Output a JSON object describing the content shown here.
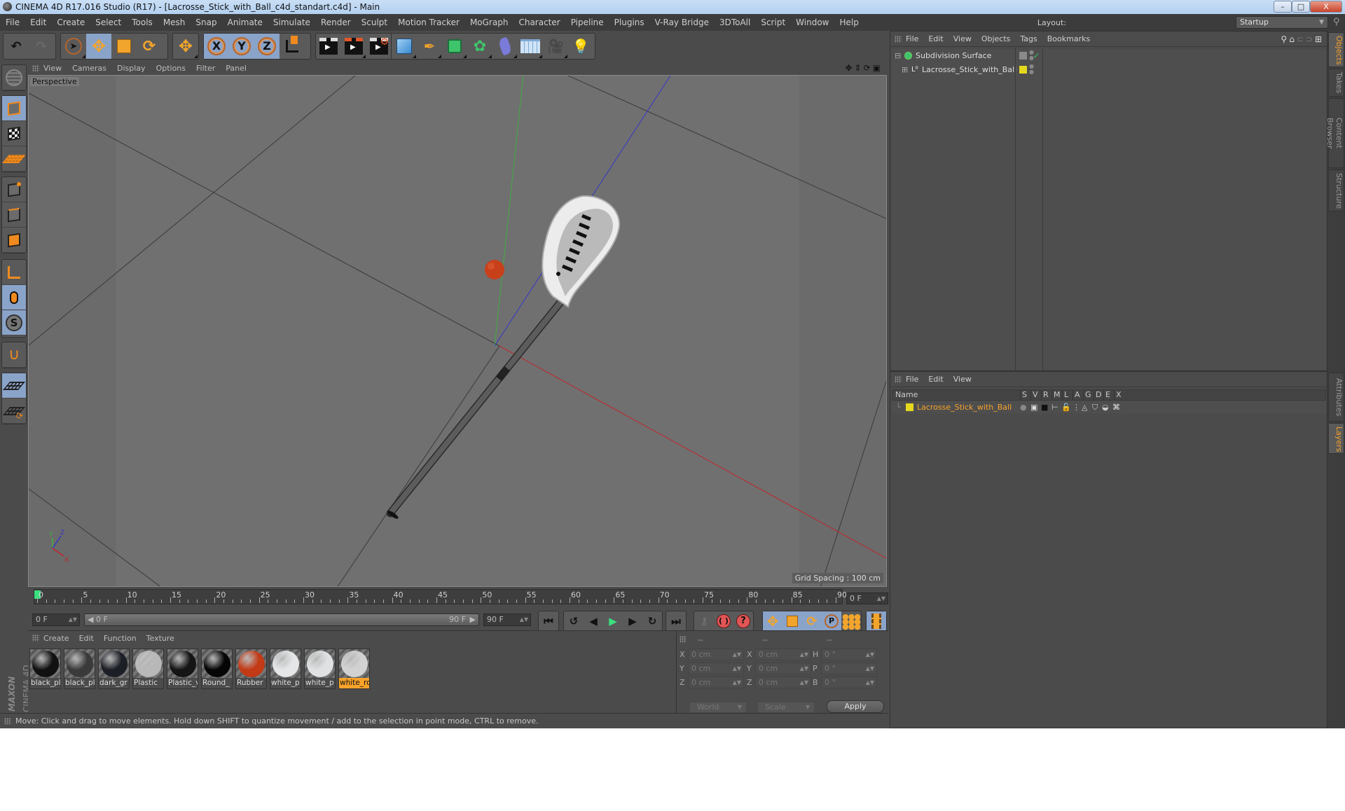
{
  "window": {
    "title": "CINEMA 4D R17.016 Studio (R17) - [Lacrosse_Stick_with_Ball_c4d_standart.c4d] - Main",
    "controls": {
      "minimize": "–",
      "maximize": "□",
      "close": "X"
    }
  },
  "menubar": {
    "items": [
      "File",
      "Edit",
      "Create",
      "Select",
      "Tools",
      "Mesh",
      "Snap",
      "Animate",
      "Simulate",
      "Render",
      "Sculpt",
      "Motion Tracker",
      "MoGraph",
      "Character",
      "Pipeline",
      "Plugins",
      "V-Ray Bridge",
      "3DToAll",
      "Script",
      "Window",
      "Help"
    ],
    "layout_label": "Layout:",
    "layout_value": "Startup"
  },
  "toolbar": {
    "groups": [
      [
        "undo-icon",
        "redo-icon"
      ],
      [
        "live-selection-icon",
        "move-icon",
        "scale-icon",
        "rotate-icon"
      ],
      [
        "recent-tool-icon"
      ],
      [
        "x-axis-icon",
        "y-axis-icon",
        "z-axis-icon",
        "coordinate-system-icon"
      ],
      [
        "render-view-icon",
        "render-picture-viewer-icon",
        "render-settings-icon"
      ],
      [
        "cube-icon",
        "pen-icon",
        "subdivision-icon",
        "cloner-icon",
        "deformer-icon",
        "floor-icon",
        "camera-icon",
        "light-icon"
      ]
    ],
    "axis_labels": [
      "X",
      "Y",
      "Z"
    ]
  },
  "left_tools": [
    "make-editable-icon",
    "model-mode-icon",
    "texture-mode-icon",
    "workplane-mode-icon",
    "points-mode-icon",
    "edges-mode-icon",
    "polygons-mode-icon",
    "axis-mode-icon",
    "tweak-mode-icon",
    "solo-icon",
    "snap-icon",
    "lock-workplane-icon",
    "workplane-align-icon"
  ],
  "viewport": {
    "menu": [
      "View",
      "Cameras",
      "Display",
      "Options",
      "Filter",
      "Panel"
    ],
    "camera_label": "Perspective",
    "grid_spacing": "Grid Spacing : 100 cm",
    "nav_icons": [
      "pan-icon",
      "dolly-icon",
      "orbit-icon",
      "maximize-view-icon"
    ],
    "axis_labels": {
      "x": "X",
      "y": "Y",
      "z": "Z"
    }
  },
  "timeline": {
    "ticks": [
      "0",
      "5",
      "10",
      "15",
      "20",
      "25",
      "30",
      "35",
      "40",
      "45",
      "50",
      "55",
      "60",
      "65",
      "70",
      "75",
      "80",
      "85",
      "90"
    ],
    "current_frame": "0 F",
    "start_frame": "0 F",
    "range_start": "0 F",
    "range_end": "90 F",
    "end_frame": "90 F",
    "playhead_frame": 0
  },
  "playback": {
    "buttons": [
      "go-to-start",
      "go-to-previous-key",
      "previous-frame",
      "play-forward",
      "next-frame",
      "go-to-next-key",
      "go-to-end",
      "record-keys",
      "autokeying",
      "keyframe-selection",
      "key-position",
      "key-scale",
      "key-rotation",
      "key-parameter",
      "key-pla",
      "timeline-window"
    ]
  },
  "materials": {
    "menu": [
      "Create",
      "Edit",
      "Function",
      "Texture"
    ],
    "items": [
      {
        "name": "black_pl",
        "color": "#111111",
        "selected": false
      },
      {
        "name": "black_pl",
        "color": "#3a3a3a",
        "selected": false
      },
      {
        "name": "dark_gr",
        "color": "#1d1f26",
        "selected": false
      },
      {
        "name": "Plastic",
        "color": "#b8b8b8",
        "selected": false
      },
      {
        "name": "Plastic_v",
        "color": "#151515",
        "selected": false
      },
      {
        "name": "Round_",
        "color": "#050505",
        "selected": false
      },
      {
        "name": "Rubber",
        "color": "#c23a16",
        "selected": false
      },
      {
        "name": "white_p",
        "color": "#e4e6e8",
        "selected": false
      },
      {
        "name": "white_p",
        "color": "#dfe1e3",
        "selected": false
      },
      {
        "name": "white_ro",
        "color": "#d2d2d2",
        "selected": true
      }
    ],
    "brand_top": "MAXON",
    "brand_bottom": "CINEMA 4D"
  },
  "coordinates": {
    "headers": [
      "--",
      "--",
      "--"
    ],
    "position": [
      {
        "axis": "X",
        "value": "0 cm"
      },
      {
        "axis": "Y",
        "value": "0 cm"
      },
      {
        "axis": "Z",
        "value": "0 cm"
      }
    ],
    "size": [
      {
        "axis": "X",
        "value": "0 cm"
      },
      {
        "axis": "Y",
        "value": "0 cm"
      },
      {
        "axis": "Z",
        "value": "0 cm"
      }
    ],
    "rotation": [
      {
        "axis": "H",
        "value": "0 °"
      },
      {
        "axis": "P",
        "value": "0 °"
      },
      {
        "axis": "B",
        "value": "0 °"
      }
    ],
    "mode_select": "World",
    "scale_select": "Scale",
    "apply_label": "Apply"
  },
  "status": {
    "message": "Move: Click and drag to move elements. Hold down SHIFT to quantize movement / add to the selection in point mode, CTRL to remove."
  },
  "objects_panel": {
    "menu": [
      "File",
      "Edit",
      "View",
      "Objects",
      "Tags",
      "Bookmarks"
    ],
    "items": [
      {
        "name": "Subdivision Surface",
        "expanded": true,
        "depth": 0
      },
      {
        "name": "Lacrosse_Stick_with_Ball",
        "expanded": false,
        "depth": 1,
        "layer_color": "#e6d81e"
      }
    ]
  },
  "layers_panel": {
    "menu": [
      "File",
      "Edit",
      "View"
    ],
    "columns": [
      "Name",
      "S",
      "V",
      "R",
      "M",
      "L",
      "A",
      "G",
      "D",
      "E",
      "X"
    ],
    "rows": [
      {
        "name": "Lacrosse_Stick_with_Ball",
        "color": "#e6d81e"
      }
    ]
  },
  "side_tabs": {
    "top": [
      {
        "label": "Objects",
        "active": true
      },
      {
        "label": "Takes",
        "active": false
      },
      {
        "label": "Content Browser",
        "active": false
      },
      {
        "label": "Structure",
        "active": false
      }
    ],
    "bottom": [
      {
        "label": "Attributes",
        "active": false
      },
      {
        "label": "Layers",
        "active": true
      }
    ]
  },
  "colors": {
    "accent": "#f7a22b",
    "active_button": "#8aa3c9",
    "playhead": "#3ae07e",
    "axis_x": "#c0262a",
    "axis_y": "#3fae3f",
    "axis_z": "#3636c8"
  }
}
